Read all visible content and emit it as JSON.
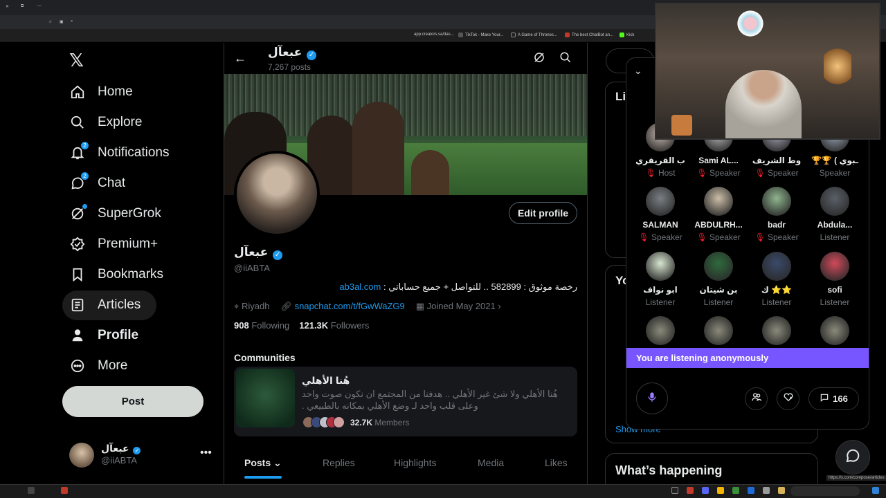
{
  "browser": {
    "bookmarks": [
      "app.creators.sa/das...",
      "TikTok - Make Your...",
      "A Game of Thrones...",
      "The best ChatBot an...",
      "Kick"
    ],
    "status_url": "https://x.com/compose/articles"
  },
  "nav": {
    "logo": "𝕏",
    "items": [
      {
        "label": "Home"
      },
      {
        "label": "Explore"
      },
      {
        "label": "Notifications",
        "badge": "2"
      },
      {
        "label": "Chat",
        "badge": "2"
      },
      {
        "label": "SuperGrok"
      },
      {
        "label": "Premium+"
      },
      {
        "label": "Bookmarks"
      },
      {
        "label": "Articles"
      },
      {
        "label": "Profile"
      },
      {
        "label": "More"
      }
    ],
    "post_label": "Post",
    "account": {
      "name": "عبعآل",
      "handle": "@iiABTA"
    }
  },
  "profile": {
    "header_name": "عبعآل",
    "posts_count": "7,267 posts",
    "edit_label": "Edit profile",
    "name": "عبعآل",
    "handle": "@iiABTA",
    "bio_text": "رخصة موثوق : 582899 .. للتواصل + جميع حساباتي : ",
    "bio_link": "ab3al.com",
    "location": "Riyadh",
    "website": "snapchat.com/t/fGwWaZG9",
    "joined": "Joined May 2021",
    "following_count": "908",
    "following_label": "Following",
    "followers_count": "121.3K",
    "followers_label": "Followers"
  },
  "communities": {
    "title": "Communities",
    "name": "هُنا الأهلي",
    "description": "هُنا الأهلي ولا شئ غير الأهلي .. هدفنا من المجتمع ان نكون صوت واحد وعلى قلب واحد لـ وضع الأهلي بمكانه بالطبيعي .",
    "member_count": "32.7K",
    "member_label": "Members"
  },
  "tabs": [
    "Posts",
    "Replies",
    "Highlights",
    "Media",
    "Likes"
  ],
  "right": {
    "live_title": "Li",
    "you_title": "Yo",
    "show_more": "Show more",
    "happening": "What’s happening"
  },
  "spaces": {
    "participants": [
      {
        "name": "ب القريقري",
        "role": "Host",
        "muted": true,
        "color": "#c9b9b0"
      },
      {
        "name": "Sami AL...",
        "role": "Speaker",
        "muted": true,
        "color": "#b8b8b8"
      },
      {
        "name": "وط الشريف",
        "role": "Speaker",
        "muted": true,
        "color": "#a4a4b4"
      },
      {
        "name": "🏆🏆 ( ـبوي",
        "role": "Speaker",
        "muted": false,
        "color": "#9aa7b8"
      },
      {
        "name": "SALMAN",
        "role": "Speaker",
        "muted": true,
        "color": "#7a7f84"
      },
      {
        "name": "ABDULRH...",
        "role": "Speaker",
        "muted": true,
        "color": "#cdbfa8"
      },
      {
        "name": "badr",
        "role": "Speaker",
        "muted": true,
        "color": "#8fb58f"
      },
      {
        "name": "Abdula...",
        "role": "Listener",
        "muted": false,
        "color": "#5a6068"
      },
      {
        "name": "ابو نواف",
        "role": "Listener",
        "muted": false,
        "color": "#d8e6d0"
      },
      {
        "name": "بن شيتان",
        "role": "Listener",
        "muted": false,
        "color": "#2e6b3c"
      },
      {
        "name": "ك ⭐⭐",
        "role": "Listener",
        "muted": false,
        "color": "#3a4a6a"
      },
      {
        "name": "sofi",
        "role": "Listener",
        "muted": false,
        "color": "#d24a5a"
      }
    ],
    "anon_text": "You are listening anonymously",
    "comments_count": "166"
  },
  "colors": {
    "accent": "#1d9bf0",
    "spaces": "#7856ff",
    "muted": "#f4212e"
  }
}
